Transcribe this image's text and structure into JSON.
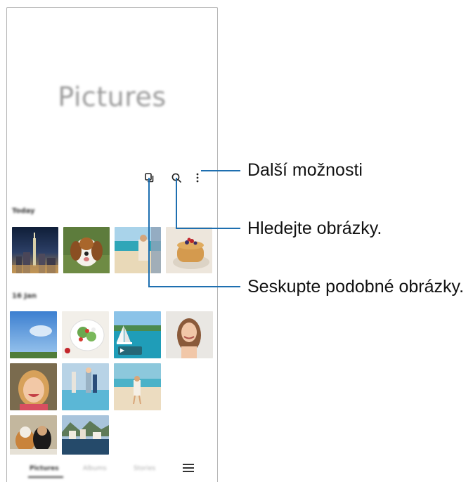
{
  "app": {
    "title": "Pictures",
    "section_today": "Today",
    "section_earlier": "16 Jan"
  },
  "toolbar": {
    "group_icon": "stack-icon",
    "search_icon": "search-icon",
    "more_icon": "more-vert-icon"
  },
  "bottom_nav": {
    "tabs": [
      {
        "label": "Pictures",
        "active": true
      },
      {
        "label": "Albums",
        "active": false
      },
      {
        "label": "Stories",
        "active": false
      }
    ],
    "menu_icon": "menu-icon"
  },
  "callouts": {
    "more_options": "Další možnosti",
    "search_pictures": "Hledejte obrázky.",
    "group_similar": "Seskupte podobné obrázky."
  },
  "colors": {
    "callout_line": "#1e6fb0"
  }
}
